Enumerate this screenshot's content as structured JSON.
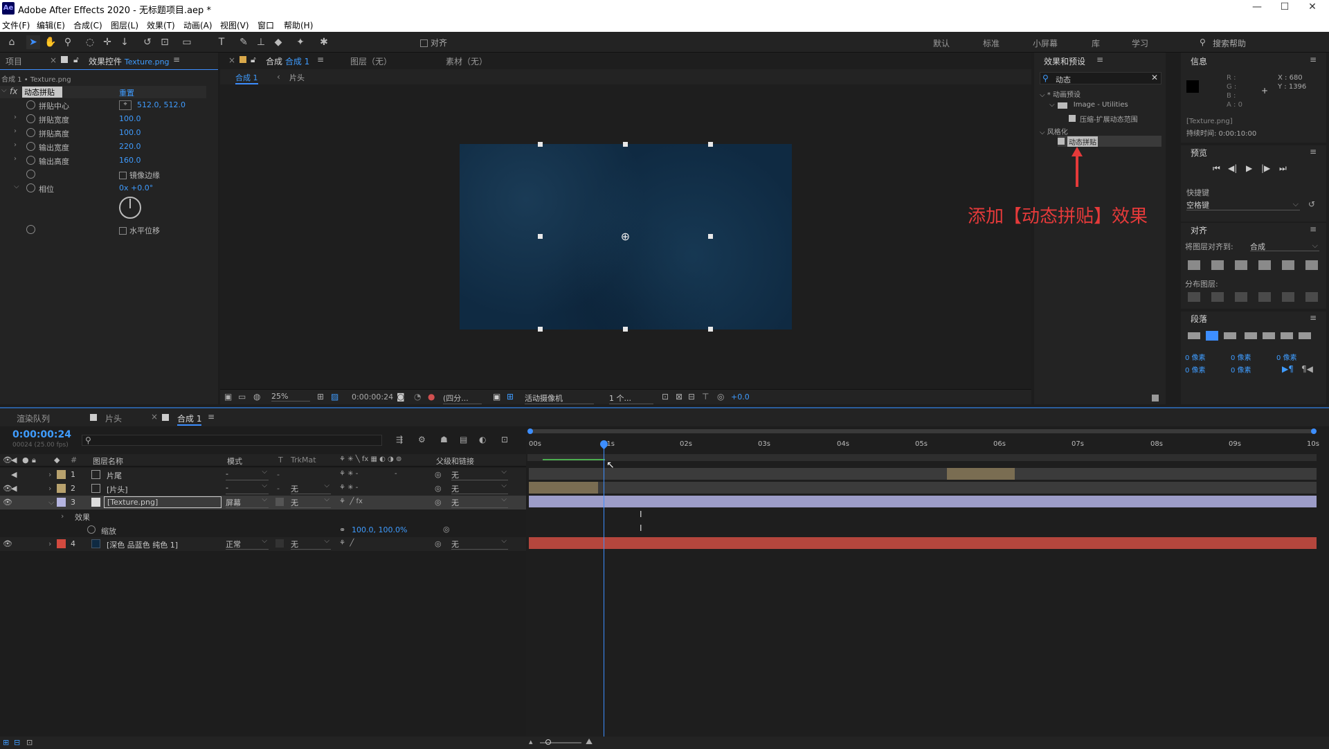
{
  "app": {
    "logo": "Ae",
    "title": "Adobe After Effects 2020 - 无标题项目.aep *"
  },
  "menu": [
    "文件(F)",
    "编辑(E)",
    "合成(C)",
    "图层(L)",
    "效果(T)",
    "动画(A)",
    "视图(V)",
    "窗口",
    "帮助(H)"
  ],
  "workspaces": [
    "默认",
    "标准",
    "小屏幕",
    "库",
    "学习"
  ],
  "search_help": "搜索帮助",
  "toolbar": {
    "align_label": "对齐"
  },
  "left_panel": {
    "tabs": [
      "项目",
      "效果控件 Texture.png"
    ],
    "tab_project": "项目",
    "tab_effect_prefix": "效果控件",
    "tab_effect_file": "Texture.png",
    "path": "合成 1 • Texture.png",
    "effect": {
      "fx": "fx",
      "name": "动态拼贴",
      "reset": "重置"
    },
    "props": [
      {
        "label": "拼贴中心",
        "value": "512.0, 512.0"
      },
      {
        "label": "拼贴宽度",
        "value": "100.0"
      },
      {
        "label": "拼贴高度",
        "value": "100.0"
      },
      {
        "label": "输出宽度",
        "value": "220.0"
      },
      {
        "label": "输出高度",
        "value": "160.0"
      },
      {
        "label": "",
        "value": "镜像边缘"
      },
      {
        "label": "相位",
        "value": "0x +0.0°"
      },
      {
        "label": "",
        "value": "水平位移"
      }
    ]
  },
  "comp_panel": {
    "tab_comp": "合成",
    "tab_comp_name": "合成 1",
    "tab_layer": "图层（无）",
    "tab_footage": "素材（无）",
    "breadcrumb": [
      "合成 1",
      "片头"
    ],
    "bottom": {
      "zoom": "25%",
      "time": "0:00:00:24",
      "res": "(四分...",
      "camera": "活动摄像机",
      "views": "1 个...",
      "exposure": "+0.0"
    }
  },
  "effects_panel": {
    "title": "效果和预设",
    "search": "动态",
    "tree": [
      {
        "label": "* 动画预设",
        "indent": 0
      },
      {
        "label": "Image - Utilities",
        "indent": 1
      },
      {
        "label": "压缩-扩展动态范围",
        "indent": 2
      },
      {
        "label": "风格化",
        "indent": 0
      },
      {
        "label": "动态拼贴",
        "indent": 1,
        "selected": true
      }
    ],
    "annotation": "添加【动态拼贴】效果"
  },
  "info_panel": {
    "title": "信息",
    "rgba": [
      "R :",
      "G :",
      "B :",
      "A : 0"
    ],
    "xy": [
      "X : 680",
      "Y : 1396"
    ],
    "file": "[Texture.png]",
    "duration": "持续时间: 0:00:10:00"
  },
  "preview_panel": {
    "title": "预览",
    "shortcut_label": "快捷键",
    "shortcut_value": "空格键"
  },
  "align_panel": {
    "title": "对齐",
    "align_to_label": "将图层对齐到:",
    "align_to_value": "合成",
    "distribute": "分布图层:"
  },
  "para_panel": {
    "title": "段落",
    "vals": [
      "0 像素",
      "0 像素",
      "0 像素",
      "0 像素",
      "0 像素"
    ]
  },
  "timeline": {
    "tabs": [
      "渲染队列",
      "片头",
      "合成 1"
    ],
    "timecode": "0:00:00:24",
    "timecode_sub": "00024 (25.00 fps)",
    "headers": {
      "num": "#",
      "name": "图层名称",
      "mode": "模式",
      "t": "T",
      "trkmat": "TrkMat",
      "parent": "父级和链接"
    },
    "ruler": [
      "00s",
      "01s",
      "02s",
      "03s",
      "04s",
      "05s",
      "06s",
      "07s",
      "08s",
      "09s",
      "10s"
    ],
    "layers": [
      {
        "num": "1",
        "name": "片尾",
        "color": "#b8a26e",
        "mode": "-",
        "trkmat": "",
        "parent": "无"
      },
      {
        "num": "2",
        "name": "[片头]",
        "color": "#b8a26e",
        "mode": "-",
        "trkmat": "无",
        "parent": "无"
      },
      {
        "num": "3",
        "name": "[Texture.png]",
        "color": "#b4b4e0",
        "mode": "屏幕",
        "trkmat": "无",
        "parent": "无"
      },
      {
        "num": "4",
        "name": "[深色 品蓝色 纯色 1]",
        "color": "#d24a3f",
        "mode": "正常",
        "trkmat": "无",
        "parent": "无"
      }
    ],
    "sub_effect": "效果",
    "sub_scale": "缩放",
    "sub_scale_val": "100.0, 100.0%"
  },
  "colors": {
    "accent": "#3f9cff",
    "annotation": "#e53a3a",
    "texture_bg": "#0f2a42"
  }
}
